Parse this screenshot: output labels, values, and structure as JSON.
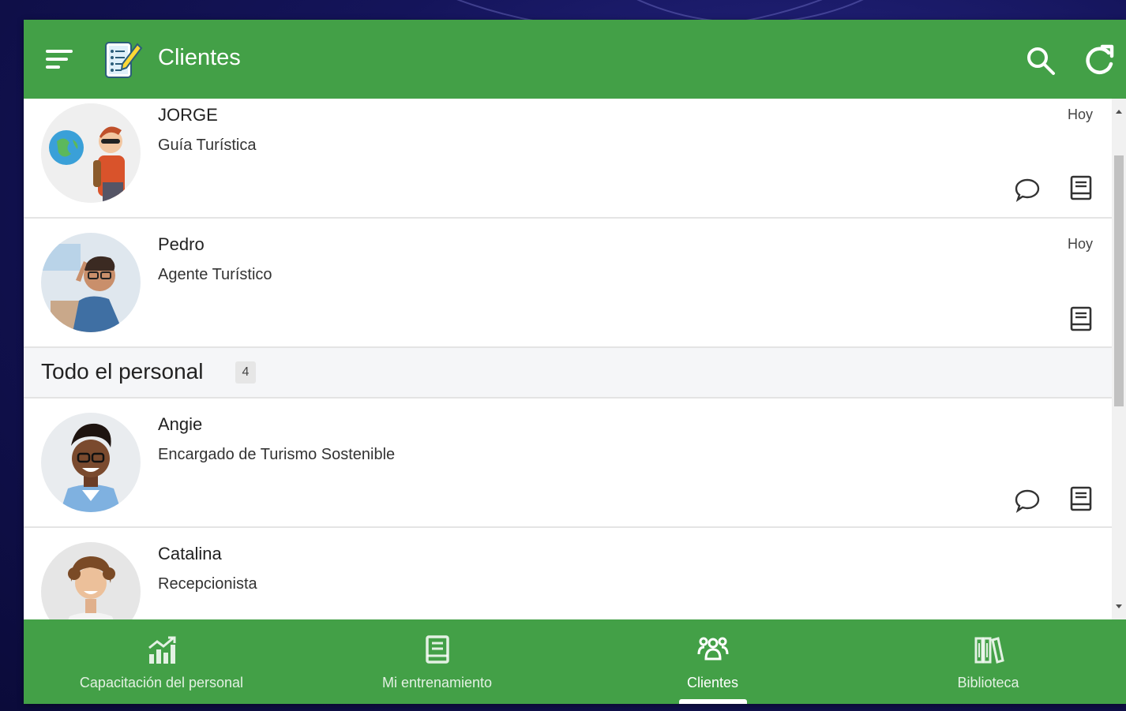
{
  "appbar": {
    "title": "Clientes",
    "icons": [
      "menu-icon",
      "checklist-pencil-icon",
      "search-icon",
      "refresh-icon"
    ]
  },
  "clients": [
    {
      "name": "JORGE",
      "role": "Guía Turística",
      "date": "Hoy",
      "has_chat": true,
      "has_book": true,
      "avatar": "tourist-with-globe-avatar"
    },
    {
      "name": "Pedro",
      "role": "Agente Turístico",
      "date": "Hoy",
      "has_chat": false,
      "has_book": true,
      "avatar": "man-with-glasses-avatar"
    }
  ],
  "section": {
    "title": "Todo el personal",
    "count": "4"
  },
  "staff": [
    {
      "name": "Angie",
      "role": "Encargado de Turismo Sostenible",
      "has_chat": true,
      "has_book": true,
      "avatar": "woman-smiling-avatar"
    },
    {
      "name": "Catalina",
      "role": "Recepcionista",
      "has_chat": false,
      "has_book": false,
      "avatar": "woman-curly-hair-avatar"
    }
  ],
  "bottom_nav": [
    {
      "label": "Capacitación del personal",
      "icon": "chart-growth-icon",
      "active": false
    },
    {
      "label": "Mi entrenamiento",
      "icon": "book-icon",
      "active": false
    },
    {
      "label": "Clientes",
      "icon": "people-group-icon",
      "active": true
    },
    {
      "label": "Biblioteca",
      "icon": "library-icon",
      "active": false
    }
  ],
  "colors": {
    "primary": "#43a047",
    "section_bg": "#f5f6f8",
    "divider": "#e4e4e4"
  }
}
